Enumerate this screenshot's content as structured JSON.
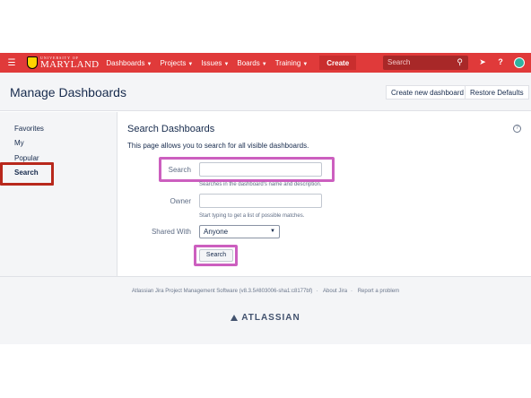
{
  "topbar": {
    "logo_small": "UNIVERSITY OF",
    "logo_big": "MARYLAND",
    "nav": [
      {
        "label": "Dashboards"
      },
      {
        "label": "Projects"
      },
      {
        "label": "Issues"
      },
      {
        "label": "Boards"
      },
      {
        "label": "Training"
      }
    ],
    "create_label": "Create",
    "search_placeholder": "Search",
    "color": "#e03a3a"
  },
  "header": {
    "title": "Manage Dashboards",
    "create_new_label": "Create new dashboard",
    "restore_label": "Restore Defaults"
  },
  "sidebar": {
    "items": [
      {
        "label": "Favorites"
      },
      {
        "label": "My"
      },
      {
        "label": "Popular"
      },
      {
        "label": "Search"
      }
    ],
    "selected": "Search"
  },
  "main": {
    "title": "Search Dashboards",
    "description": "This page allows you to search for all visible dashboards.",
    "search_label": "Search",
    "search_value": "",
    "search_hint": "Searches in the dashboard's name and description.",
    "owner_label": "Owner",
    "owner_value": "",
    "owner_hint": "Start typing to get a list of possible matches.",
    "shared_label": "Shared With",
    "shared_value": "Anyone",
    "search_button": "Search"
  },
  "footer": {
    "software": "Atlassian Jira Project Management Software (v8.3.5#803006-sha1:c8177bf)",
    "about": "About Jira",
    "report": "Report a problem",
    "brand": "ATLASSIAN"
  },
  "highlight_color": "#cc5fbf",
  "selected_color": "#b8281c"
}
